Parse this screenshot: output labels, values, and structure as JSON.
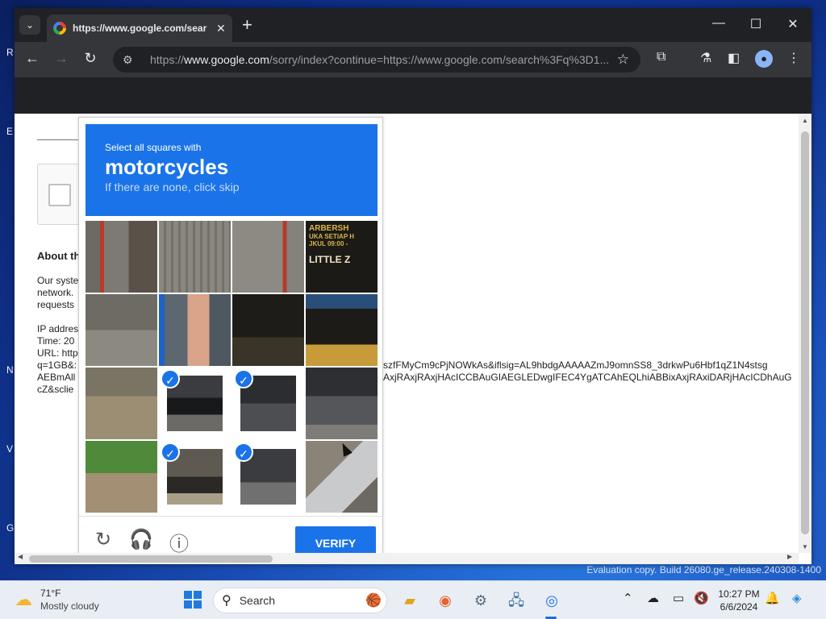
{
  "desktop": {
    "letters": [
      "R",
      "E",
      "N",
      "V",
      "G"
    ],
    "watermark": "Evaluation copy. Build 26080.ge_release.240308-1400"
  },
  "browser": {
    "tab_title": "https://www.google.com/sear",
    "url_prefix": "https://",
    "url_host": "www.google.com",
    "url_rest": "/sorry/index?continue=https://www.google.com/search%3Fq%3D1..."
  },
  "page": {
    "about": "About th",
    "lines": [
      "Our syste",
      "network.",
      "requests",
      "IP addres",
      "Time: 20",
      "URL: http",
      "q=1GB&:",
      "AEBmAll",
      "cZ&sclie"
    ],
    "overflow_line_1": "szfFMyCm9cPjNOWkAs&iflsig=AL9hbdgAAAAAZmJ9omnSS8_3drkwPu6Hbf1qZ1N4stsg",
    "overflow_line_2": "AxjRAxjRAxjHAcICCBAuGIAEGLEDwgIFEC4YgATCAhEQLhiABBixAxjRAxiDARjHAcICDhAuG"
  },
  "captcha": {
    "instruction_small": "Select all squares with",
    "target": "motorcycles",
    "hint": "If there are none, click skip",
    "verify_label": "VERIFY",
    "selected_tiles": [
      9,
      10,
      13,
      14
    ],
    "tile_texts": {
      "t3": "ARBERSH",
      "t3b": "UKA SETIAP H",
      "t3c": "JKUL 09:00 -",
      "t3d": "LITTLE Z"
    }
  },
  "taskbar": {
    "temperature": "71°F",
    "weather": "Mostly cloudy",
    "search_placeholder": "Search",
    "time": "10:27 PM",
    "date": "6/6/2024"
  }
}
